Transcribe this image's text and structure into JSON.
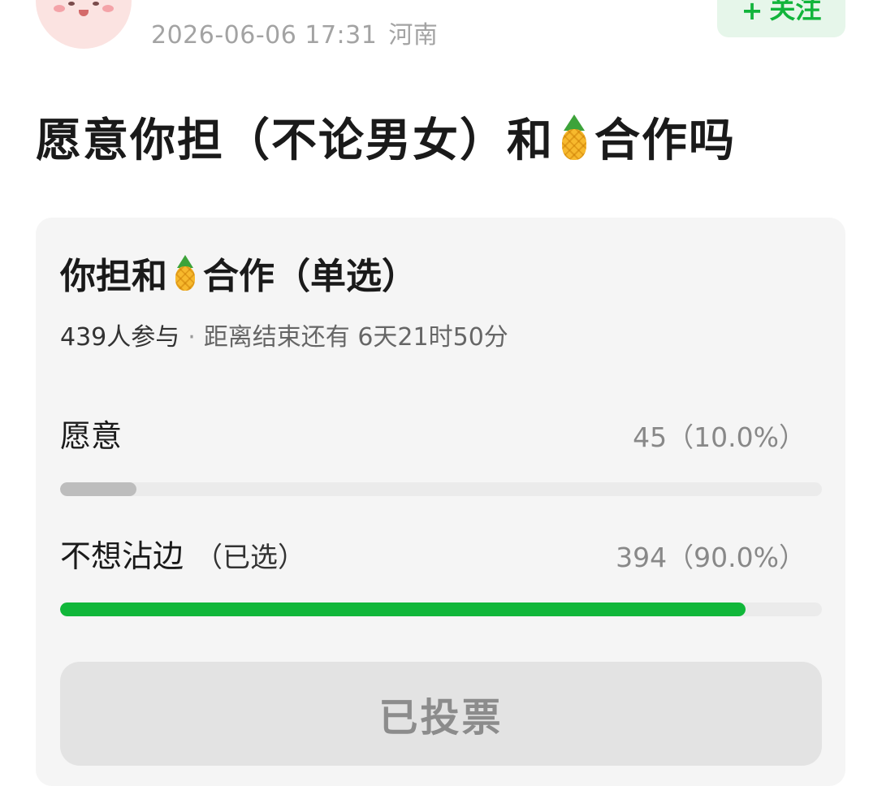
{
  "post": {
    "timestamp": "2026-06-06 17:31",
    "location": "河南",
    "follow_plus": "+",
    "follow_label": "关注",
    "title_before": "愿意你担（不论男女）和",
    "title_emoji": "pineapple",
    "title_after": "合作吗"
  },
  "poll": {
    "title_before": "你担和",
    "title_emoji": "pineapple",
    "title_after": "合作（单选）",
    "participants": "439人参与",
    "separator": "·",
    "remaining": "距离结束还有 6天21时50分",
    "options": [
      {
        "label": "愿意",
        "selected_note": "",
        "value_text": "45（10.0%）",
        "percent": 10.0,
        "bar_color": "#bdbdbd"
      },
      {
        "label": "不想沾边",
        "selected_note": "（已选）",
        "value_text": "394（90.0%）",
        "percent": 90.0,
        "bar_color": "#11b73a"
      }
    ],
    "voted_label": "已投票"
  },
  "colors": {
    "accent": "#11b73a",
    "follow_bg": "#e6f6ea",
    "card_bg": "#f5f5f5"
  }
}
